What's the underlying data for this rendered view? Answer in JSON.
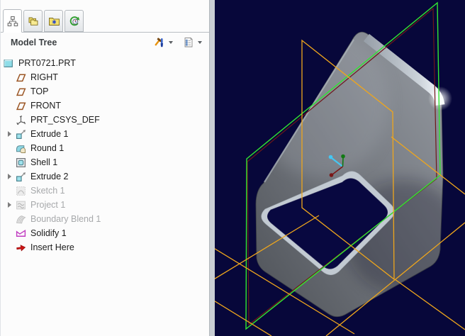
{
  "panel": {
    "tabs": [
      {
        "id": "model-tree",
        "icon": "tab-model-tree",
        "active": true
      },
      {
        "id": "folder-browser",
        "icon": "tab-folders",
        "active": false
      },
      {
        "id": "favorites",
        "icon": "tab-favorites",
        "active": false
      },
      {
        "id": "history",
        "icon": "tab-history",
        "active": false
      }
    ],
    "header": {
      "title": "Model Tree",
      "tools_icon": "tools-icon",
      "settings_icon": "settings-icon"
    },
    "tree": [
      {
        "label": "PRT0721.PRT",
        "icon": "part",
        "root": true
      },
      {
        "label": "RIGHT",
        "icon": "datum-plane"
      },
      {
        "label": "TOP",
        "icon": "datum-plane"
      },
      {
        "label": "FRONT",
        "icon": "datum-plane"
      },
      {
        "label": "PRT_CSYS_DEF",
        "icon": "csys"
      },
      {
        "label": "Extrude 1",
        "icon": "extrude",
        "expandable": true
      },
      {
        "label": "Round 1",
        "icon": "round"
      },
      {
        "label": "Shell 1",
        "icon": "shell"
      },
      {
        "label": "Extrude 2",
        "icon": "extrude",
        "expandable": true
      },
      {
        "label": "Sketch 1",
        "icon": "sketch",
        "suppressed": true
      },
      {
        "label": "Project 1",
        "icon": "project",
        "suppressed": true,
        "expandable": true
      },
      {
        "label": "Boundary Blend 1",
        "icon": "boundary-blend",
        "suppressed": true
      },
      {
        "label": "Solidify 1",
        "icon": "solidify"
      },
      {
        "label": "Insert Here",
        "icon": "insert-here"
      }
    ]
  },
  "viewport": {
    "background": "#07073a",
    "colors": {
      "plane_orange": "#efa61c",
      "plane_green": "#32e632",
      "plane_shadow": "#6e1818",
      "csys_cyan": "#45c6f2",
      "csys_green": "#117a14",
      "csys_maroon": "#7a1717",
      "part_mid": "#70747b",
      "part_highlight": "#f2f6fa"
    }
  }
}
